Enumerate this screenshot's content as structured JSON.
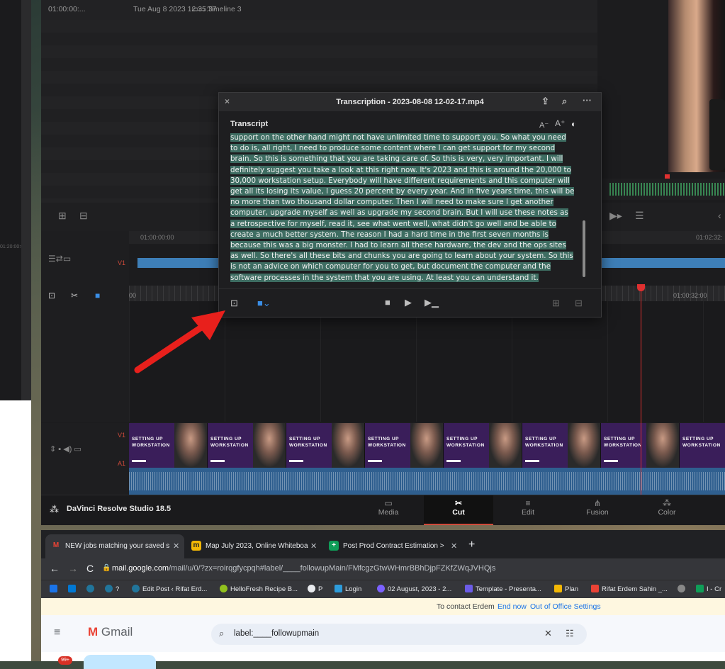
{
  "left_partial": {
    "snippet": "01:20:00:00"
  },
  "resolve": {
    "timecode": "01:00:00:...",
    "date": "Tue Aug 8 2023 12:35:37",
    "timeline": "Timeline 3",
    "ruler_start": "01:00:00:00",
    "ruler_right": "01:02:32:",
    "ruler2_left": "00",
    "ruler2_right": "01:00:32:00",
    "track_v1": "V1",
    "track_v1b": "V1",
    "track_a1": "A1",
    "clip_text": "SETTING UP WORKSTATION",
    "brand": "DaVinci Resolve Studio 18.5",
    "pages": [
      {
        "label": "Media",
        "icon": "▭"
      },
      {
        "label": "Cut",
        "icon": "✂"
      },
      {
        "label": "Edit",
        "icon": "≡"
      },
      {
        "label": "Fusion",
        "icon": "⋔"
      },
      {
        "label": "Color",
        "icon": "⁂"
      }
    ],
    "active_page": "Cut"
  },
  "dialog": {
    "title": "Transcription - 2023-08-08 12-02-17.mp4",
    "section": "Transcript",
    "font_dec": "A⁻",
    "font_inc": "A⁺",
    "lines": [
      "support on the other hand might not have unlimited time to support you. So what you need",
      "to do is, all right, I need to produce some content where I can get support for my second",
      "brain. So this is something that you are taking care of. So this is very, very important. I will",
      "definitely suggest you take a look at this right now. It's 2023 and this is around the 20,000 to",
      "30,000 workstation setup. Everybody will have different requirements and this computer will",
      "get all its losing its value, I guess 20 percent by every year. And in five years time, this will be",
      "no more than two thousand dollar computer. Then I will need to make sure I get another",
      "computer, upgrade myself as well as upgrade my second brain. But I will use these notes as",
      "a retrospective for myself, read it, see what went well, what didn't go well and be able to",
      "create a much better system. The reason I had a hard time in the first seven months is",
      "because this was a big monster. I had to learn all these hardware, the dev and the ops sites",
      "as well. So there's all these bits and chunks you are going to learn about your system. So this",
      "is not an advice on which computer for you to get, but document the computer and the",
      "software processes in the system that you are using. At least you can understand it."
    ]
  },
  "chrome": {
    "tabs": [
      {
        "label": "NEW jobs matching your saved s",
        "fav": "M",
        "color": "#ea4335"
      },
      {
        "label": "Map July 2023, Online Whiteboa",
        "fav": "m",
        "color": "#f2b705"
      },
      {
        "label": "Post Prod Contract Estimation >",
        "fav": "+",
        "color": "#0f9d58"
      }
    ],
    "url_host": "mail.google.com",
    "url_path": "/mail/u/0/?zx=roirqgfycpqh#label/____followupMain/FMfcgzGtwWHmrBBhDjpFZKfZWqJVHQjs",
    "bookmarks": [
      {
        "label": "",
        "color": "#1a73e8"
      },
      {
        "label": "",
        "color": "#0078d4"
      },
      {
        "label": "",
        "color": "#21759b"
      },
      {
        "label": "?",
        "color": "#21759b"
      },
      {
        "label": "Edit Post ‹ Rifat Erd...",
        "color": "#21759b"
      },
      {
        "label": "HelloFresh Recipe B...",
        "color": "#91c11e"
      },
      {
        "label": "P",
        "color": "#e8eaed"
      },
      {
        "label": "Login",
        "color": "#2d9cdb"
      },
      {
        "label": "02 August, 2023 - 2...",
        "color": "#7b61ff"
      },
      {
        "label": "Template - Presenta...",
        "color": "#6c5ce7"
      },
      {
        "label": "Plan",
        "color": "#f2b705"
      },
      {
        "label": "Rifat Erdem Sahin _...",
        "color": "#ea4335"
      },
      {
        "label": "",
        "color": "#888"
      },
      {
        "label": "I - Cr",
        "color": "#0f9d58"
      }
    ],
    "notice": {
      "text": "To contact Erdem",
      "end": "End now",
      "settings": "Out of Office Settings"
    },
    "gmail": {
      "logo": "Gmail",
      "search": "label:____followupmain",
      "badge": "99+"
    }
  }
}
